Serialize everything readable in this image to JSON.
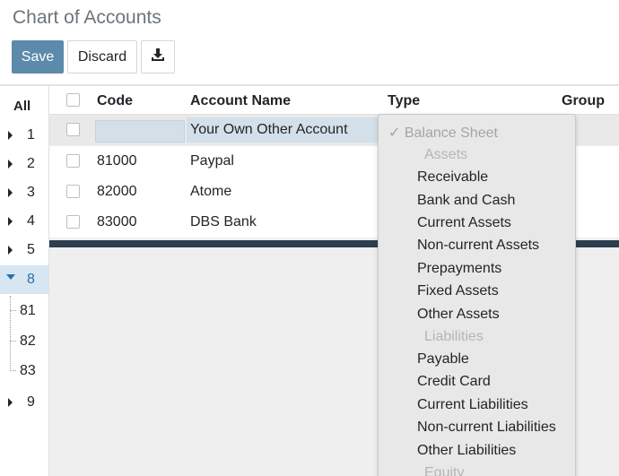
{
  "page": {
    "title": "Chart of Accounts"
  },
  "toolbar": {
    "save_label": "Save",
    "discard_label": "Discard",
    "download_icon": "download-icon"
  },
  "sidebar": {
    "all_label": "All",
    "items": [
      {
        "label": "1",
        "expanded": false
      },
      {
        "label": "2",
        "expanded": false
      },
      {
        "label": "3",
        "expanded": false
      },
      {
        "label": "4",
        "expanded": false
      },
      {
        "label": "5",
        "expanded": false
      },
      {
        "label": "8",
        "expanded": true
      },
      {
        "label": "9",
        "expanded": false
      }
    ],
    "subitems": [
      "81",
      "82",
      "83"
    ]
  },
  "table": {
    "columns": {
      "code": "Code",
      "name": "Account Name",
      "type": "Type",
      "group": "Group"
    },
    "editing_row": {
      "code": "",
      "name": "Your Own Other Account"
    },
    "rows": [
      {
        "code": "81000",
        "name": "Paypal"
      },
      {
        "code": "82000",
        "name": "Atome"
      },
      {
        "code": "83000",
        "name": "DBS Bank"
      }
    ]
  },
  "type_dropdown": {
    "selected": "✓ Balance Sheet",
    "groups": {
      "assets": "Assets",
      "liabilities": "Liabilities",
      "equity": "Equity"
    },
    "asset_options": [
      "Receivable",
      "Bank and Cash",
      "Current Assets",
      "Non-current Assets",
      "Prepayments",
      "Fixed Assets",
      "Other Assets"
    ],
    "liability_options": [
      "Payable",
      "Credit Card",
      "Current Liabilities",
      "Non-current Liabilities",
      "Other Liabilities"
    ]
  },
  "colors": {
    "primary": "#5c8aaa",
    "dark_bar": "#2c3e4f",
    "active_sidebar": "#d7e6f3",
    "input_bg": "#d3e0e9"
  }
}
